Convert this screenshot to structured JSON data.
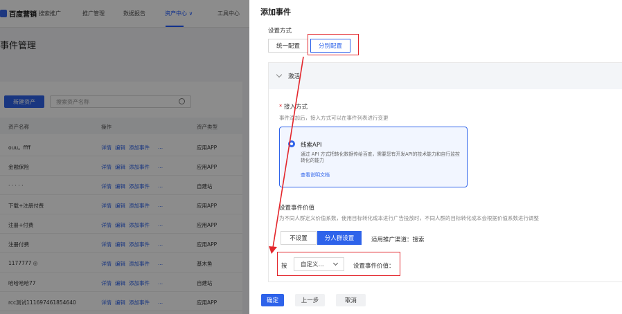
{
  "background": {
    "brand_name": "百度营销",
    "brand_sub": "搜索推广",
    "nav": [
      "推广管理",
      "数据报告",
      "资产中心 ∨",
      "工具中心"
    ],
    "page_title": "事件管理",
    "new_button": "新建资产",
    "search_placeholder": "搜索资产名称",
    "columns": [
      "资产名称",
      "操作",
      "资产类型"
    ],
    "row_ops": [
      "详情",
      "编辑",
      "添加事件",
      "..."
    ],
    "rows": [
      {
        "name": "ouu。ffff",
        "type": "应用APP"
      },
      {
        "name": "金融保险",
        "type": "应用APP"
      },
      {
        "name": "· · · · ·",
        "type": "自建站"
      },
      {
        "name": "下载+注册付费",
        "type": "应用APP"
      },
      {
        "name": "注册+付费",
        "type": "应用APP"
      },
      {
        "name": "注册付费",
        "type": "应用APP"
      },
      {
        "name": "1177777 ◎",
        "type": "基木鱼"
      },
      {
        "name": "哈哈哈哈77",
        "type": "自建站"
      },
      {
        "name": "rcc测试1116974618546​40",
        "type": "应用APP"
      }
    ]
  },
  "drawer": {
    "title": "添加事件",
    "config_label": "设置方式",
    "config_options": [
      "统一配置",
      "分别配置"
    ],
    "section_label": "激活",
    "access_label": "接入方式",
    "access_required": "*",
    "access_help": "事件添加后，接入方式可以在事件列表进行变更",
    "api_title": "线索API",
    "api_desc": "通过 API 方式把转化数据传给百度，需要您有开发API的技术能力和自行监控转化的能力",
    "api_link": "查看说明文档",
    "value_label": "设置事件价值",
    "value_help": "为不同人群定义价值系数，使用目标转化成本进行广告投放时，不同人群的目标转化成本会根据价值系数进行调整",
    "value_options": [
      "不设置",
      "分人群设置"
    ],
    "channel_text": "适用推广渠道：搜索",
    "by_label": "按",
    "select_value": "自定义...",
    "set_value_label": "设置事件价值：",
    "confirm": "确定",
    "prev": "上一步",
    "cancel": "取消"
  },
  "colors": {
    "accent": "#2e63ea",
    "annotation_red": "#e3262c",
    "overlay": "rgba(0,0,0,0.45)"
  }
}
